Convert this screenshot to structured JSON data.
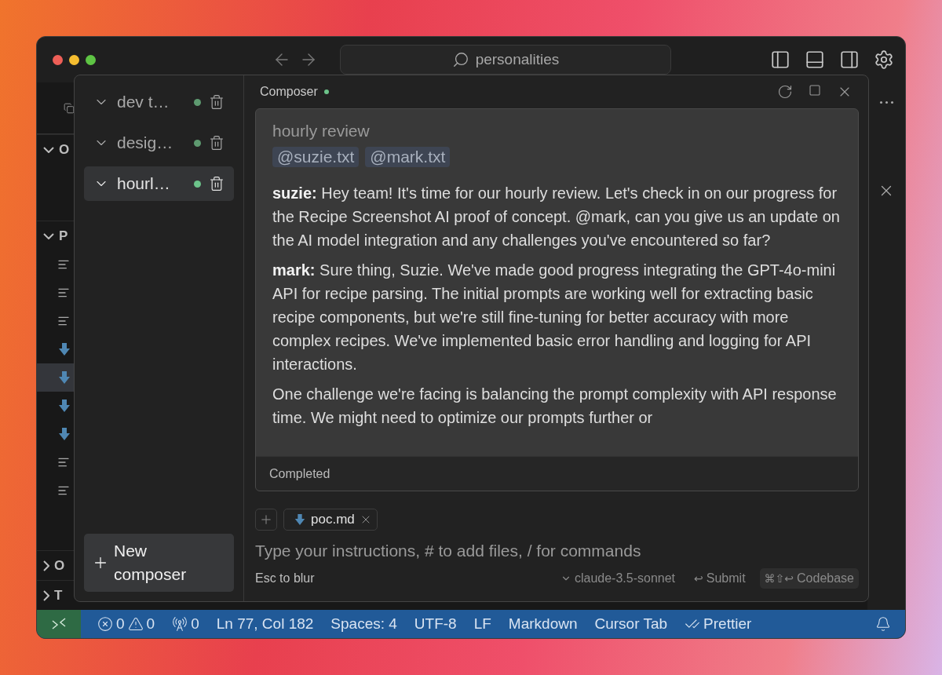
{
  "window": {
    "search": {
      "value": "personalities"
    }
  },
  "explorer": {
    "sections": [
      {
        "label": "O",
        "expanded": true
      },
      {
        "label": "P",
        "expanded": true
      }
    ],
    "files": [
      {
        "kind": "text",
        "selected": false
      },
      {
        "kind": "text",
        "selected": false
      },
      {
        "kind": "text",
        "selected": false
      },
      {
        "kind": "markdown",
        "selected": false
      },
      {
        "kind": "markdown",
        "selected": true
      },
      {
        "kind": "markdown",
        "selected": false
      },
      {
        "kind": "markdown",
        "selected": false
      },
      {
        "kind": "text",
        "selected": false
      },
      {
        "kind": "text",
        "selected": false
      }
    ],
    "bottom_sections": [
      {
        "label": "O",
        "expanded": false
      },
      {
        "label": "T",
        "expanded": false
      }
    ]
  },
  "composer": {
    "title": "Composer",
    "sessions": [
      {
        "label": "dev t…",
        "color": "#5e9a70",
        "selected": false
      },
      {
        "label": "desig…",
        "color": "#5e9a70",
        "selected": false
      },
      {
        "label": "hourl…",
        "color": "#6cc38a",
        "selected": true
      }
    ],
    "new_button": "New composer",
    "conversation": {
      "title": "hourly review",
      "mentions": [
        "@suzie.txt",
        "@mark.txt"
      ],
      "messages": [
        "**suzie:** Hey team! It's time for our hourly review. Let's check in on our progress for the Recipe Screenshot AI proof of concept. @mark, can you give us an update on the AI model integration and any challenges you've encountered so far?",
        "**mark:** Sure thing, Suzie. We've made good progress integrating the GPT-4o-mini API for recipe parsing. The initial prompts are working well for extracting basic recipe components, but we're still fine-tuning for better accuracy with more complex recipes. We've implemented basic error handling and logging for API interactions.",
        "One challenge we're facing is balancing the prompt complexity with API response time. We might need to optimize our prompts further or"
      ],
      "status": "Completed"
    },
    "attachments": [
      {
        "label": "poc.md",
        "kind": "markdown"
      }
    ],
    "input": {
      "placeholder": "Type your instructions, # to add files, / for commands"
    },
    "hint": "Esc to blur",
    "model": "claude-3.5-sonnet",
    "submit": {
      "keys": "↩",
      "label": "Submit"
    },
    "codebase": {
      "keys": "⌘⇧↩",
      "label": "Codebase"
    }
  },
  "status_bar": {
    "errors": "0",
    "warnings": "0",
    "ports": "0",
    "items": [
      "Ln 77, Col 182",
      "Spaces: 4",
      "UTF-8",
      "LF",
      "Markdown",
      "Cursor Tab"
    ],
    "formatter": "Prettier"
  }
}
